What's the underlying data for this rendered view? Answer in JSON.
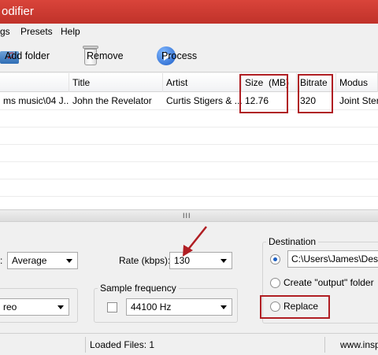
{
  "window": {
    "title": "odifier"
  },
  "menu": [
    "gs",
    "Presets",
    "Help"
  ],
  "toolbar": {
    "add_folder": "Add folder",
    "remove": "Remove",
    "process": "Process"
  },
  "table": {
    "columns": [
      "Title",
      "Artist",
      "Size  (MB)",
      "Bitrate",
      "Modus"
    ],
    "rows": [
      {
        "path": "ms music\\04 J...",
        "title": "John the Revelator",
        "artist": "Curtis Stigers & ...",
        "size": "12.76",
        "bitrate": "320",
        "modus": "Joint Stere"
      }
    ]
  },
  "splitter": {
    "grip": "III"
  },
  "encoding": {
    "mode_label": ":",
    "mode_value": "Average",
    "rate_label": "Rate (kbps):",
    "rate_value": "130",
    "channel_value": "reo",
    "sample_frequency": {
      "title": "Sample frequency",
      "checked": false,
      "value": "44100 Hz"
    }
  },
  "destination": {
    "title": "Destination",
    "path": "C:\\Users\\James\\Deskt",
    "create_output_label": "Create \"output\" folder",
    "replace_label": "Replace",
    "selected": "path"
  },
  "status": {
    "loaded": "Loaded Files: 1",
    "url": "www.insp"
  },
  "colors": {
    "title_bar": "#c9392f",
    "highlight": "#b01e23"
  }
}
